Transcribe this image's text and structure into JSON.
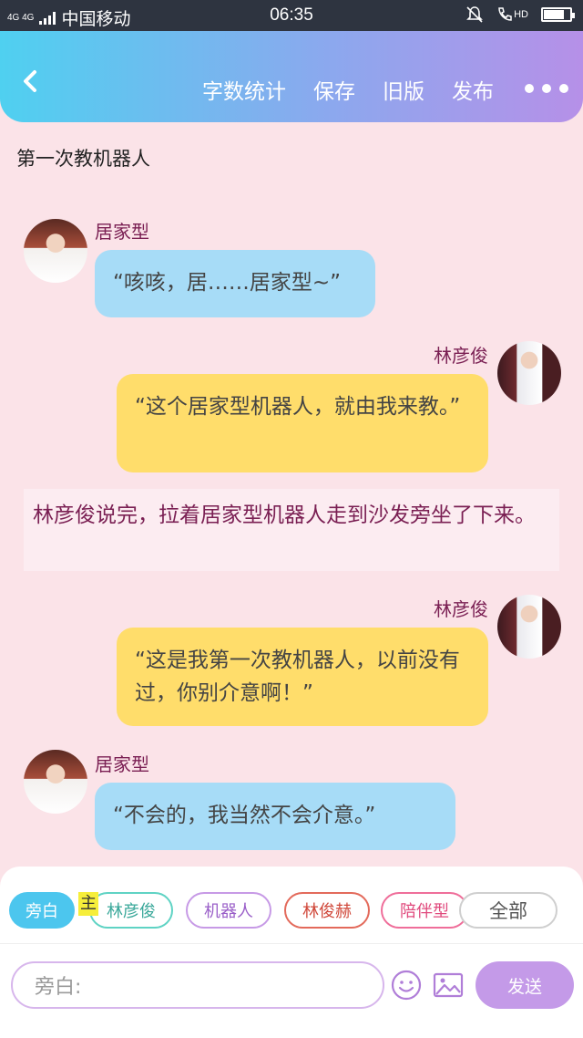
{
  "status_bar": {
    "network": "4G 4G",
    "carrier": "中国移动",
    "time": "06:35",
    "hd_label": "HD",
    "battery_level": 0.8
  },
  "header": {
    "actions": {
      "word_count": "字数统计",
      "save": "保存",
      "old_version": "旧版",
      "publish": "发布"
    }
  },
  "story": {
    "title": "第一次教机器人",
    "messages": [
      {
        "speaker": "居家型",
        "text": "“咳咳，居……居家型~”"
      },
      {
        "speaker": "林彦俊",
        "text": "“这个居家型机器人，就由我来教。”"
      },
      {
        "narration": "林彦俊说完，拉着居家型机器人走到沙发旁坐了下来。"
      },
      {
        "speaker": "林彦俊",
        "text": "“这是我第一次教机器人，以前没有过，你别介意啊！”"
      },
      {
        "speaker": "居家型",
        "text": "“不会的，我当然不会介意。”"
      }
    ]
  },
  "composer": {
    "roles": {
      "narration": "旁白",
      "main_mark": "主",
      "lin_yanjun": "林彦俊",
      "robot": "机器人",
      "lin_junhe": "林俊赫",
      "companion": "陪伴型",
      "all": "全部"
    },
    "input_placeholder": "旁白:",
    "send_label": "发送"
  },
  "colors": {
    "header_gradient_start": "#4fd0f0",
    "header_gradient_end": "#b690e8",
    "page_background": "#fbe3e8",
    "bubble_blue": "#a7dcf7",
    "bubble_yellow": "#ffdd6b",
    "speaker_text": "#7a1f53",
    "send_button": "#c49ae8"
  },
  "icons": {
    "back": "chevron-left-icon",
    "more": "more-dots-icon",
    "emoji": "smiley-icon",
    "image": "image-icon",
    "mute": "bell-off-icon",
    "call": "phone-hd-icon",
    "battery": "battery-icon",
    "signal": "signal-icon"
  }
}
